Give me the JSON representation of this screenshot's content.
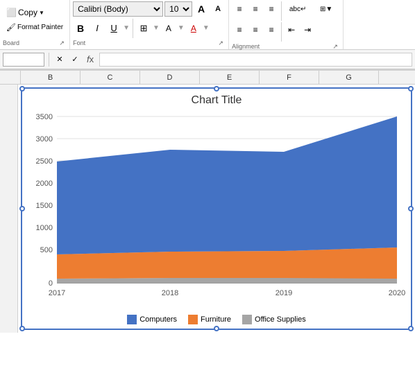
{
  "ribbon": {
    "font_name": "Calibri (Body)",
    "font_size": "10",
    "sections": {
      "clipboard": {
        "label": "Board",
        "copy_label": "Copy",
        "format_painter_label": "Format Painter"
      },
      "font": {
        "label": "Font",
        "bold": "B",
        "italic": "I",
        "underline": "U"
      },
      "alignment": {
        "label": "Alignment"
      }
    }
  },
  "formula_bar": {
    "name_box_value": "",
    "formula_value": ""
  },
  "columns": [
    "B",
    "C",
    "D",
    "E",
    "F",
    "G"
  ],
  "chart": {
    "title": "Chart Title",
    "y_axis_labels": [
      "3500",
      "3000",
      "2500",
      "2000",
      "1500",
      "1000",
      "500",
      "0"
    ],
    "x_axis_labels": [
      "2017",
      "2018",
      "2019",
      "2020"
    ],
    "series": [
      {
        "name": "Computers",
        "color": "#4472c4",
        "data": [
          1950,
          2150,
          2080,
          2950
        ]
      },
      {
        "name": "Furniture",
        "color": "#ed7d31",
        "data": [
          520,
          560,
          580,
          650
        ]
      },
      {
        "name": "Office Supplies",
        "color": "#a5a5a5",
        "data": [
          80,
          90,
          95,
          100
        ]
      }
    ]
  },
  "legend": {
    "items": [
      {
        "label": "Computers",
        "color": "#4472c4"
      },
      {
        "label": "Furniture",
        "color": "#ed7d31"
      },
      {
        "label": "Office Supplies",
        "color": "#a5a5a5"
      }
    ]
  }
}
